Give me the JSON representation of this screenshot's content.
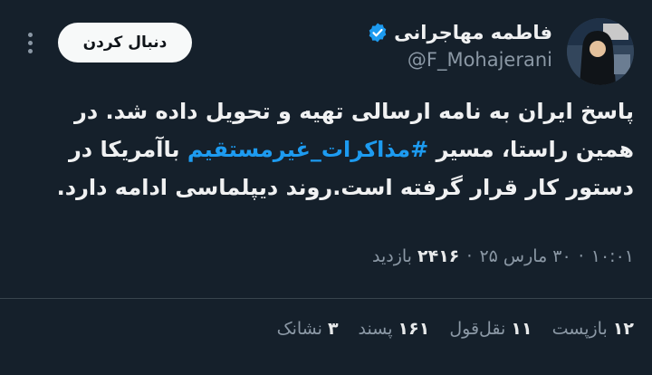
{
  "author": {
    "name": "فاطمه مهاجرانی",
    "handle": "@F_Mohajerani",
    "verified": true
  },
  "follow_button_label": "دنبال کردن",
  "tweet": {
    "text_before": "پاسخ ایران به نامه ارسالی تهیه و تحویل داده شد. در همین راستا، مسیر ",
    "hashtag": "#مذاکرات_غیرمستقیم",
    "text_after": " باآمریکا در دستور کار قرار گرفته است.روند دیپلماسی ادامه دارد."
  },
  "meta": {
    "time": "۱۰:۰۱",
    "date": "۳۰ مارس ۲۵",
    "views_count": "۲۴۱۶",
    "views_label": "بازدید"
  },
  "stats": {
    "retweets": {
      "count": "۱۲",
      "label": "بازپست"
    },
    "quotes": {
      "count": "۱۱",
      "label": "نقل‌قول"
    },
    "likes": {
      "count": "۱۶۱",
      "label": "پسند"
    },
    "bookmarks": {
      "count": "۳",
      "label": "نشانک"
    }
  },
  "colors": {
    "background": "#15202b",
    "link": "#1d9bf0",
    "verified_badge": "#1d9bf0",
    "secondary_text": "#8b98a5"
  }
}
